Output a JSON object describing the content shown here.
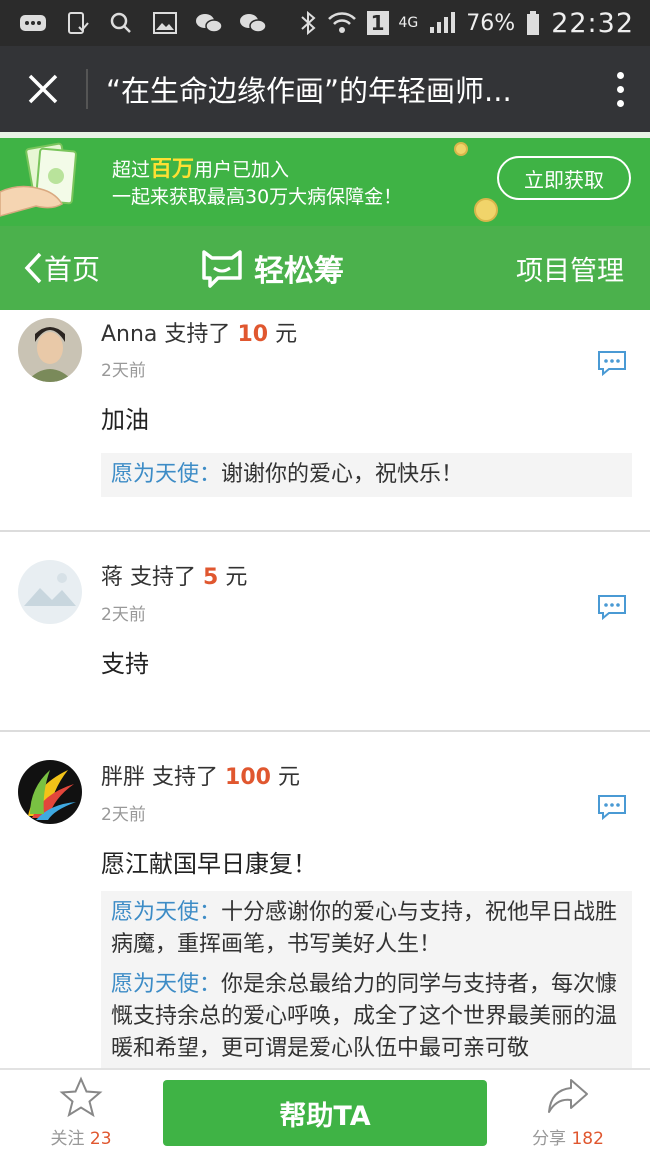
{
  "status_bar": {
    "network": "4G",
    "battery": "76%",
    "time": "22:32",
    "sim_badge": "1"
  },
  "title_bar": {
    "title": "“在生命边缘作画”的年轻画师..."
  },
  "banner": {
    "line1_prefix": "超过",
    "line1_highlight": "百万",
    "line1_suffix": "用户已加入",
    "line2": "一起来获取最高30万大病保障金！",
    "button_label": "立即获取"
  },
  "nav": {
    "back_label": "首页",
    "brand": "轻松筹",
    "manage_label": "项目管理"
  },
  "comments": [
    {
      "name": "Anna",
      "action": "支持了",
      "amount": "10",
      "unit": "元",
      "time": "2天前",
      "message": "加油",
      "replies": [
        {
          "who": "愿为天使：",
          "text": "谢谢你的爱心，祝快乐！"
        }
      ]
    },
    {
      "name": "蒋",
      "action": "支持了",
      "amount": "5",
      "unit": "元",
      "time": "2天前",
      "message": "支持",
      "replies": []
    },
    {
      "name": "胖胖",
      "action": "支持了",
      "amount": "100",
      "unit": "元",
      "time": "2天前",
      "message": "愿江献国早日康复！",
      "replies": [
        {
          "who": "愿为天使：",
          "text": "十分感谢你的爱心与支持，祝他早日战胜病魔，重挥画笔，书写美好人生！"
        },
        {
          "who": "愿为天使：",
          "text": "你是余总最给力的同学与支持者，每次慷慨支持余总的爱心呼唤，成全了这个世界最美丽的温暖和希望，更可谓是爱心队伍中最可亲可敬"
        }
      ]
    }
  ],
  "bottom_bar": {
    "follow_label": "关注",
    "follow_count": "23",
    "help_label": "帮助TA",
    "share_label": "分享",
    "share_count": "182"
  },
  "colors": {
    "brand_green": "#4bb14c",
    "amount_red": "#e0572f",
    "reply_blue": "#3d8cc6"
  }
}
